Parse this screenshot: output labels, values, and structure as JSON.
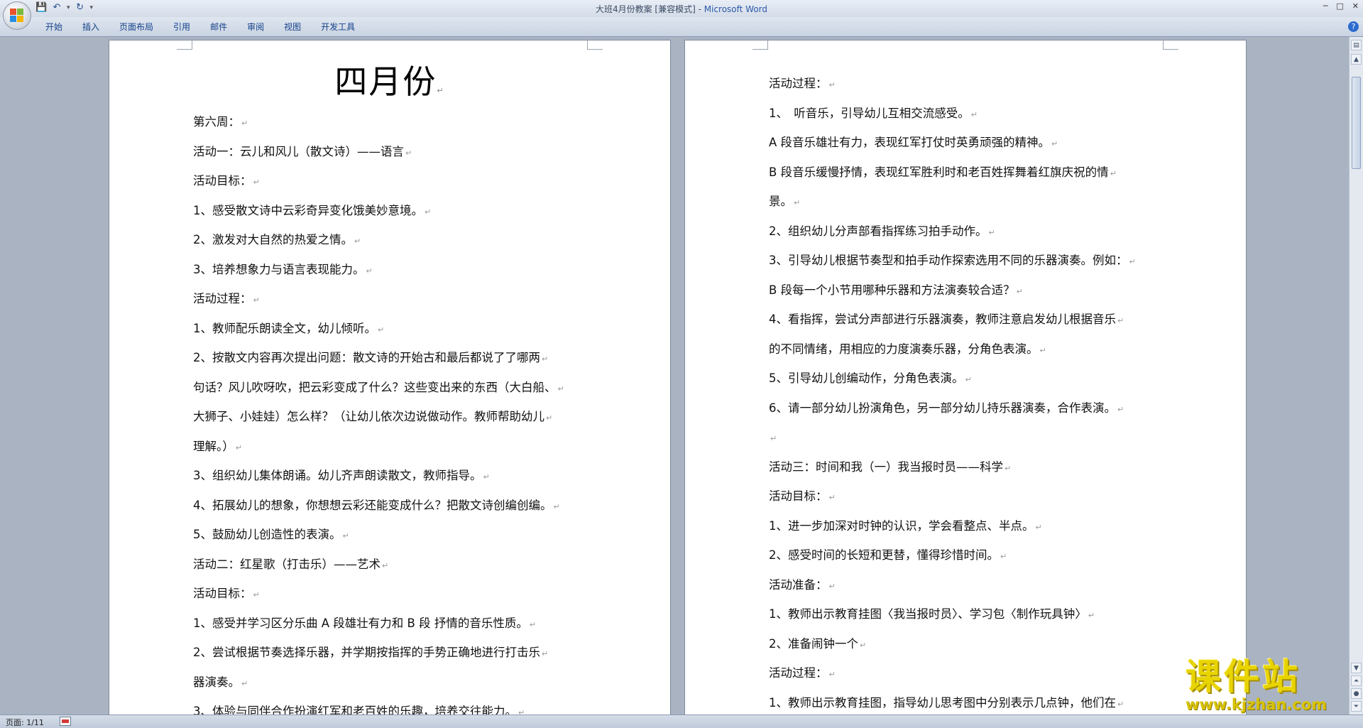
{
  "titlebar": {
    "doc_name": "大班4月份教案 [兼容模式] - ",
    "app_name": "Microsoft Word",
    "qat": {
      "save_icon": "save-icon",
      "undo_icon": "undo-icon",
      "redo_icon": "redo-icon",
      "customize": "▾"
    },
    "controls": [
      "─",
      "□",
      "✕"
    ]
  },
  "ribbon": {
    "tabs": [
      "开始",
      "插入",
      "页面布局",
      "引用",
      "邮件",
      "审阅",
      "视图",
      "开发工具"
    ],
    "help": "?"
  },
  "left_page": {
    "title": "四月份",
    "lines": [
      "第六周：",
      "活动一：云儿和风儿（散文诗）——语言",
      "活动目标：",
      "1、感受散文诗中云彩奇异变化饿美妙意境。",
      "2、激发对大自然的热爱之情。",
      "3、培养想象力与语言表现能力。",
      "活动过程：",
      "1、教师配乐朗读全文，幼儿倾听。",
      "2、按散文内容再次提出问题：散文诗的开始古和最后都说了了哪两",
      "句话？风儿吹呀吹，把云彩变成了什么？这些变出来的东西（大白船、",
      "大狮子、小娃娃）怎么样？（让幼儿依次边说做动作。教师帮助幼儿",
      "理解。）",
      "3、组织幼儿集体朗诵。幼儿齐声朗读散文，教师指导。",
      "4、拓展幼儿的想象，你想想云彩还能变成什么？把散文诗创编创编。",
      "5、鼓励幼儿创造性的表演。",
      "活动二：红星歌（打击乐）——艺术",
      "活动目标：",
      "1、感受并学习区分乐曲 A 段雄壮有力和 B 段 抒情的音乐性质。",
      "2、尝试根据节奏选择乐器，并学期按指挥的手势正确地进行打击乐",
      "器演奏。",
      "3、体验与同伴合作扮演红军和老百姓的乐趣，培养交往能力。"
    ]
  },
  "right_page": {
    "lines": [
      "活动过程：",
      "1、　听音乐，引导幼儿互相交流感受。",
      " A 段音乐雄壮有力，表现红军打仗时英勇顽强的精神。",
      " B  段音乐缓慢抒情，表现红军胜利时和老百姓挥舞着红旗庆祝的情",
      "景。",
      "2、组织幼儿分声部看指挥练习拍手动作。",
      "3、引导幼儿根据节奏型和拍手动作探索选用不同的乐器演奏。例如：",
      "B 段每一个小节用哪种乐器和方法演奏较合适？",
      "4、看指挥，尝试分声部进行乐器演奏，教师注意启发幼儿根据音乐",
      "的不同情绪，用相应的力度演奏乐器，分角色表演。",
      "5、引导幼儿创编动作，分角色表演。",
      "6、请一部分幼儿扮演角色，另一部分幼儿持乐器演奏，合作表演。",
      "",
      "活动三：时间和我（一）我当报时员——科学",
      "活动目标：",
      "1、进一步加深对时钟的认识，学会看整点、半点。",
      "2、感受时间的长短和更替，懂得珍惜时间。",
      "活动准备：",
      "1、教师出示教育挂图〈我当报时员〉、学习包〈制作玩具钟〉",
      "2、准备闹钟一个",
      "活动过程：",
      "1、教师出示教育挂图，指导幼儿思考图中分别表示几点钟，他们在"
    ]
  },
  "paragraph_mark": "↵",
  "statusbar": {
    "page": "页面: 1/11"
  },
  "watermark": {
    "name": "课件站",
    "url": "www.kjzhan.com"
  },
  "colors": {
    "background": "#a9b3c2",
    "ribbon_text": "#15428b",
    "watermark": "#e8d400"
  }
}
